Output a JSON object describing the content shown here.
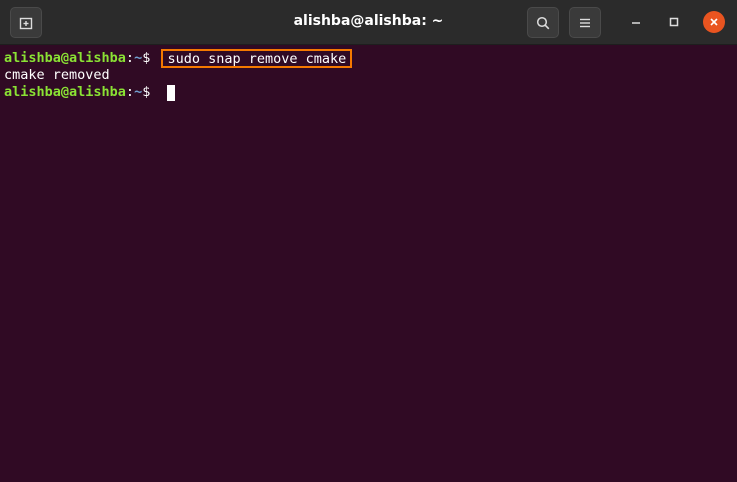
{
  "window": {
    "title": "alishba@alishba: ~"
  },
  "icons": {
    "new_tab": "new-tab-icon",
    "search": "search-icon",
    "menu": "hamburger-menu-icon",
    "minimize": "minimize-icon",
    "maximize": "maximize-icon",
    "close": "close-icon"
  },
  "colors": {
    "background": "#300a24",
    "prompt_user": "#8ae234",
    "prompt_path": "#729fcf",
    "highlight": "#f57900",
    "close_button": "#e95420"
  },
  "terminal": {
    "lines": [
      {
        "user": "alishba@alishba",
        "sep": ":",
        "path": "~",
        "symbol": "$ ",
        "command": "sudo snap remove cmake"
      },
      {
        "output": "cmake removed"
      },
      {
        "user": "alishba@alishba",
        "sep": ":",
        "path": "~",
        "symbol": "$ "
      }
    ]
  }
}
